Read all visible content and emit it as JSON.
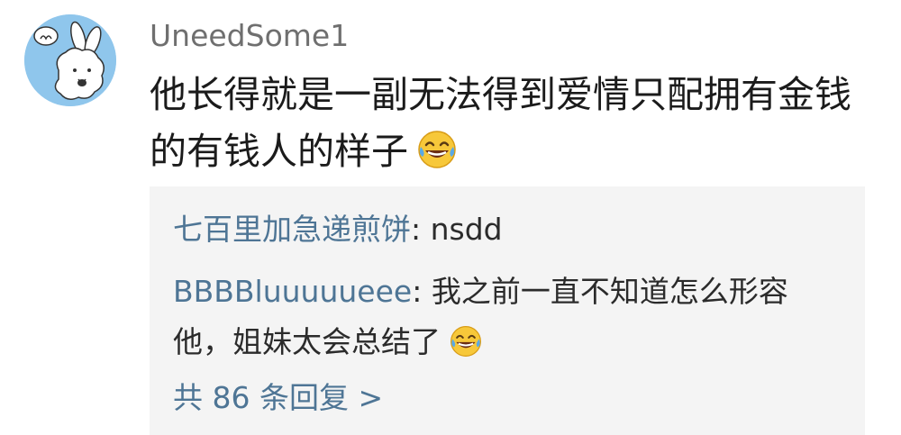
{
  "comment": {
    "username": "UneedSome1",
    "avatar_icon": "rabbit-avatar-icon",
    "text": "他长得就是一副无法得到爱情只配拥有金钱的有钱人的样子",
    "emoji_icon": "laugh-cry-emoji-icon"
  },
  "replies": [
    {
      "author": "七百里加急递煎饼",
      "separator": ": ",
      "text": "nsdd"
    },
    {
      "author": "BBBBluuuuueee",
      "separator": ": ",
      "text": "我之前一直不知道怎么形容他，姐妹太会总结了",
      "emoji_icon": "laugh-cry-emoji-icon"
    }
  ],
  "more_replies": {
    "label": "共 86 条回复 >"
  },
  "colors": {
    "link_blue": "#4e7595",
    "username_gray": "#6f6f6f",
    "reply_background": "#f4f4f4",
    "avatar_blue": "#8fc6ec"
  }
}
